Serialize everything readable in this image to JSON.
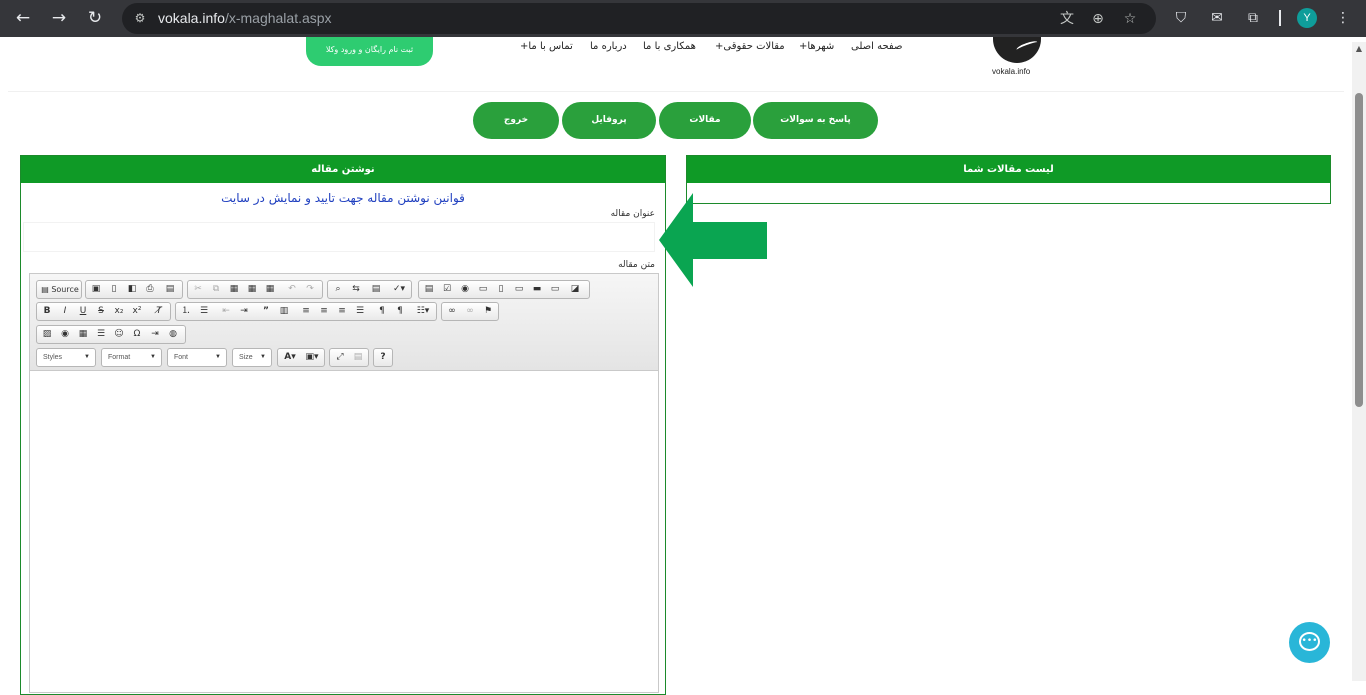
{
  "browser": {
    "url_host": "vokala.info",
    "url_path": "/x-maghalat.aspx",
    "profile_initial": "Y",
    "nav_icons": [
      "back-icon",
      "forward-icon",
      "reload-icon"
    ],
    "omnibox_icons": [
      "site-settings-icon",
      "translate-icon",
      "zoom-icon",
      "bookmark-star-icon"
    ],
    "extension_icons": [
      "shield-extension-icon",
      "mail-extension-icon",
      "puzzle-extensions-icon"
    ]
  },
  "site": {
    "logo_text": "vokala.info",
    "nav": {
      "home": "صفحه اصلی",
      "cities": "شهرها+",
      "articles": "مقالات حقوقی+",
      "cooperate": "همکاری با ما",
      "about": "درباره ما",
      "contact": "تماس با ما+"
    },
    "register_button": "ثبت نام رایگان و ورود وکلا"
  },
  "user_menu": {
    "answer": "پاسخ به سوالات",
    "articles": "مقالات",
    "profile": "پروفایل",
    "logout": "خروج"
  },
  "list_panel": {
    "title": "لیست مقالات شما"
  },
  "write_panel": {
    "title": "نوشتن مقاله",
    "rules_link": "قوانین نوشتن مقاله جهت تایید و نمایش در سایت",
    "title_label": "عنوان مقاله",
    "title_value": "",
    "body_label": "متن مقاله"
  },
  "editor": {
    "source_label": "Source",
    "combos": {
      "styles": "Styles",
      "format": "Format",
      "font": "Font",
      "size": "Size"
    },
    "help": "?"
  },
  "colors": {
    "green_header": "#0f9a26",
    "pill_green": "#2aa03c",
    "register_green": "#2ecc71",
    "arrow_green": "#0aa551",
    "link_blue": "#1f3fbf",
    "chat_blue": "#29b6d8"
  }
}
